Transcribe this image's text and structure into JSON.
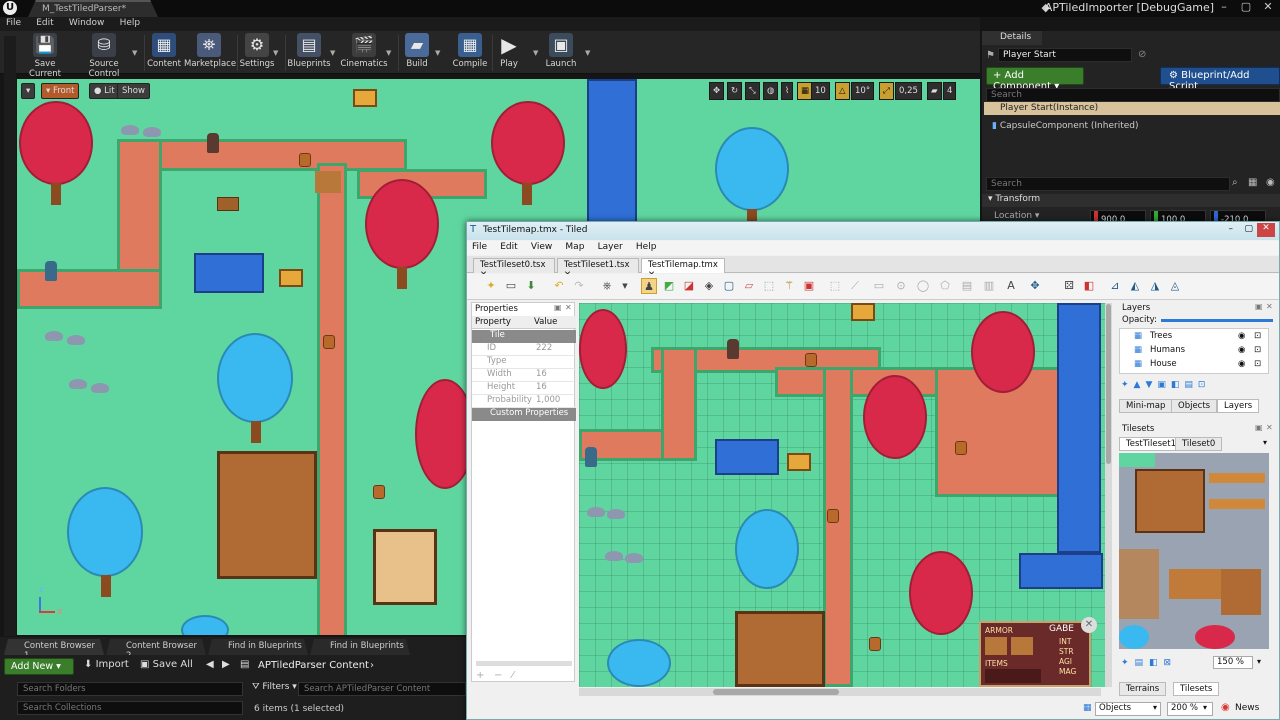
{
  "ue": {
    "window_tab": "M_TestTiledParser*",
    "project_title": "APTiledImporter [DebugGame]",
    "menu": [
      "File",
      "Edit",
      "Window",
      "Help"
    ],
    "toolbar": [
      "Save Current",
      "Source Control",
      "Content",
      "Marketplace",
      "Settings",
      "Blueprints",
      "Cinematics",
      "Build",
      "Compile",
      "Play",
      "Launch"
    ],
    "viewport": {
      "front": "Front",
      "lit": "Lit",
      "show": "Show",
      "grid_snap": "10",
      "rotation_snap": "10°",
      "scale_snap": "0,25",
      "camera_speed": "4",
      "axis_x": "x",
      "axis_z": "z"
    },
    "details": {
      "tab": "Details",
      "actor_name": "Player Start",
      "add_component": "+ Add Component ▾",
      "blueprint_script": "Blueprint/Add Script",
      "search_placeholder": "Search",
      "selected_row": "Player Start(Instance)",
      "component": "CapsuleComponent (Inherited)",
      "search2_placeholder": "Search",
      "transform": "Transform",
      "location_label": "Location ▾",
      "loc_x": "900,0",
      "loc_y": "100,0",
      "loc_z": "-210,0"
    },
    "content_browser": {
      "tabs": [
        "Content Browser 1",
        "Content Browser 2",
        "Find in Blueprints",
        "Find in Blueprints"
      ],
      "add_new": "Add New ▾",
      "import": "Import",
      "save_all": "Save All",
      "breadcrumb": "APTiledParser Content",
      "search_folders": "Search Folders",
      "search_collections": "Search Collections",
      "filters": "Filters ▾",
      "search_content": "Search APTiledParser Content",
      "items_count": "6 items (1 selected)"
    }
  },
  "tiled": {
    "title": "TestTilemap.tmx - Tiled",
    "menu": [
      "File",
      "Edit",
      "View",
      "Map",
      "Layer",
      "Help"
    ],
    "tabs": [
      "TestTileset0.tsx",
      "TestTileset1.tsx",
      "TestTilemap.tmx"
    ],
    "properties": {
      "header": "Properties",
      "col_property": "Property",
      "col_value": "Value",
      "section_tile": "Tile",
      "rows": [
        {
          "name": "ID",
          "value": "222"
        },
        {
          "name": "Type",
          "value": ""
        },
        {
          "name": "Width",
          "value": "16"
        },
        {
          "name": "Height",
          "value": "16"
        },
        {
          "name": "Probability",
          "value": "1,000"
        }
      ],
      "section_custom": "Custom Properties"
    },
    "layers": {
      "header": "Layers",
      "opacity_label": "Opacity:",
      "items": [
        "Trees",
        "Humans",
        "House"
      ],
      "bottom_tabs": [
        "Mini-map",
        "Objects",
        "Layers"
      ]
    },
    "tilesets": {
      "header": "Tilesets",
      "tabs": [
        "TestTileset1",
        "Tileset0"
      ],
      "zoom": "150 %",
      "bottom_tabs": [
        "Terrains",
        "Tilesets"
      ]
    },
    "status": {
      "layer_select": "Objects",
      "zoom": "200 %",
      "news": "News"
    },
    "hud": {
      "name": "GABE",
      "armor": "ARMOR",
      "items": "ITEMS",
      "stats": [
        "INT",
        "STR",
        "AGI",
        "MAG"
      ]
    }
  }
}
